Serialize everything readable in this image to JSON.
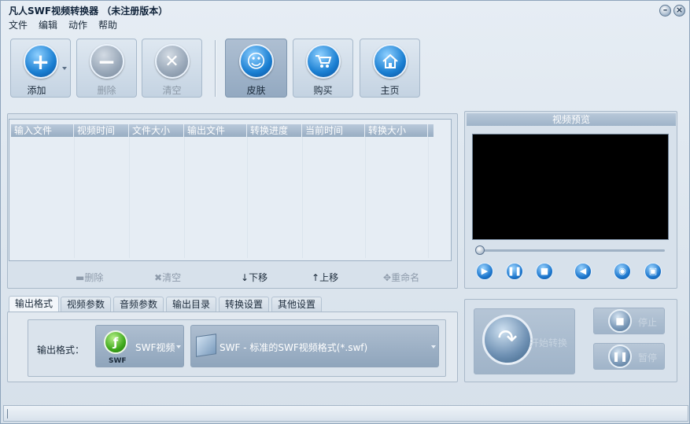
{
  "window": {
    "title": "凡人SWF视频转换器 （未注册版本）"
  },
  "menu": [
    "文件",
    "编辑",
    "动作",
    "帮助"
  ],
  "toolbar": {
    "add": "添加",
    "delete": "删除",
    "clear": "清空",
    "skin": "皮肤",
    "buy": "购买",
    "home": "主页"
  },
  "file_list": {
    "columns": [
      "输入文件",
      "视频时间",
      "文件大小",
      "输出文件",
      "转换进度",
      "当前时间",
      "转换大小"
    ]
  },
  "list_actions": {
    "delete": "删除",
    "clear": "清空",
    "move_down": "下移",
    "move_up": "上移",
    "rename": "重命名"
  },
  "preview": {
    "title": "视频预览"
  },
  "tabs": [
    "输出格式",
    "视频参数",
    "音频参数",
    "输出目录",
    "转换设置",
    "其他设置"
  ],
  "output_format": {
    "label": "输出格式：",
    "category": "SWF视频",
    "icon_caption": "SWF",
    "format": "SWF - 标准的SWF视频格式(*.swf)"
  },
  "convert": {
    "start": "开始转换",
    "stop": "停止",
    "pause": "暂停"
  }
}
